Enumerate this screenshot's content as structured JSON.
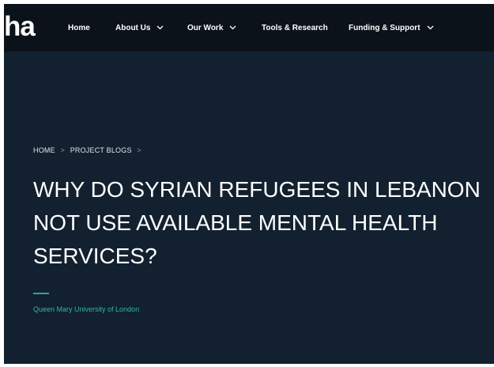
{
  "header": {
    "logo_text": "ha",
    "nav": [
      {
        "label": "Home",
        "has_dropdown": false
      },
      {
        "label": "About Us",
        "has_dropdown": true
      },
      {
        "label": "Our Work",
        "has_dropdown": true
      },
      {
        "label": "Tools & Research",
        "has_dropdown": false
      },
      {
        "label": "Funding & Support",
        "has_dropdown": true
      }
    ]
  },
  "breadcrumb": {
    "items": [
      "HOME",
      "PROJECT BLOGS"
    ],
    "separator": ">"
  },
  "page": {
    "title": "WHY DO SYRIAN REFUGEES IN LEBANON NOT USE AVAILABLE MENTAL HEALTH SERVICES?",
    "author": "Queen Mary University of London"
  },
  "colors": {
    "background": "#12202f",
    "navbar": "#0c1219",
    "accent": "#2aa79b"
  }
}
